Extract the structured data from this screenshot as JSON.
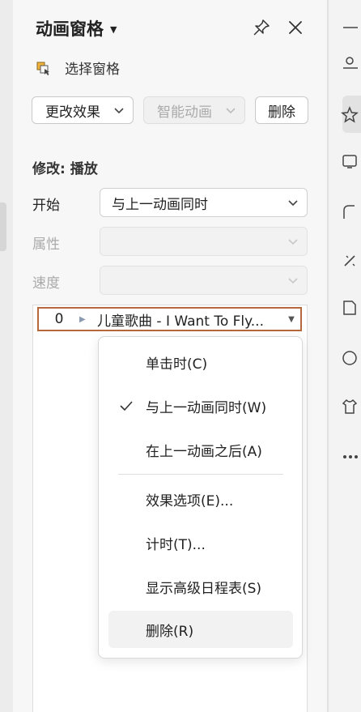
{
  "pane": {
    "title": "动画窗格",
    "select_pane_label": "选择窗格"
  },
  "toolbar": {
    "change_effect": "更改效果",
    "smart_animation": "智能动画",
    "delete": "删除"
  },
  "modify": {
    "section_label": "修改: 播放",
    "start_label": "开始",
    "start_value": "与上一动画同时",
    "property_label": "属性",
    "speed_label": "速度"
  },
  "animation_list": [
    {
      "index": "0",
      "name": "儿童歌曲 - I Want To Fly..."
    }
  ],
  "context_menu": {
    "items": [
      {
        "label": "单击时(C)",
        "checked": false
      },
      {
        "label": "与上一动画同时(W)",
        "checked": true
      },
      {
        "label": "在上一动画之后(A)",
        "checked": false
      },
      {
        "label": "效果选项(E)...",
        "checked": false
      },
      {
        "label": "计时(T)...",
        "checked": false
      },
      {
        "label": "显示高级日程表(S)",
        "checked": false
      },
      {
        "label": "删除(R)",
        "checked": false,
        "hovered": true
      }
    ]
  },
  "icons": {
    "title_caret": "caret-down-icon",
    "pin": "pin-icon",
    "close": "close-icon",
    "select_pane": "select-pane-icon",
    "dropdown": "chevron-down-icon",
    "play": "play-triangle-icon",
    "check": "checkmark-icon"
  }
}
